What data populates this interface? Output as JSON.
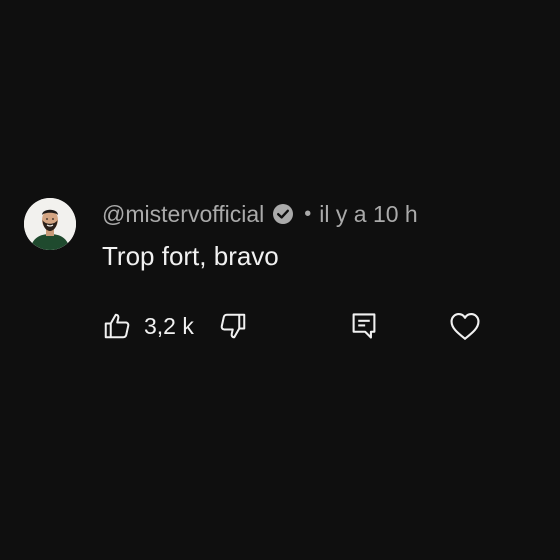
{
  "comment": {
    "author": "@mistervofficial",
    "separator": "•",
    "time": "il y a 10 h",
    "text": "Trop fort, bravo",
    "like_count": "3,2 k"
  },
  "icons": {
    "verified": "verified-check-icon",
    "like": "thumbs-up-icon",
    "dislike": "thumbs-down-icon",
    "reply": "reply-comment-icon",
    "heart": "heart-icon"
  },
  "colors": {
    "background": "#0f0f0f",
    "primary_text": "#f1f1f1",
    "secondary_text": "#aaaaaa"
  }
}
